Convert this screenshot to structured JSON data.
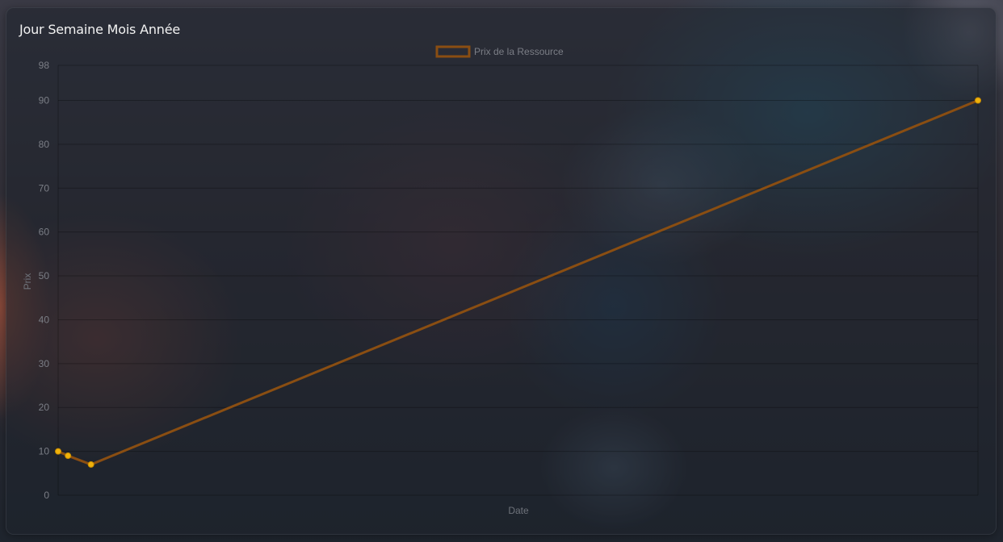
{
  "header": {
    "title": "Jour Semaine Mois Année"
  },
  "colors": {
    "line": "#8a4e12",
    "point": "#f0b20c",
    "point_border": "#c98d00"
  },
  "chart_data": {
    "type": "line",
    "title": "",
    "xlabel": "Date",
    "ylabel": "Prix",
    "ylim": [
      0,
      98
    ],
    "yticks": [
      0,
      10,
      20,
      30,
      40,
      50,
      60,
      70,
      80,
      90,
      98
    ],
    "xlim": [
      0,
      28
    ],
    "grid": true,
    "legend_position": "top-center",
    "series": [
      {
        "name": "Prix de la Ressource",
        "x": [
          0,
          0.3,
          1,
          28
        ],
        "values": [
          10,
          9,
          7,
          90
        ]
      }
    ]
  }
}
